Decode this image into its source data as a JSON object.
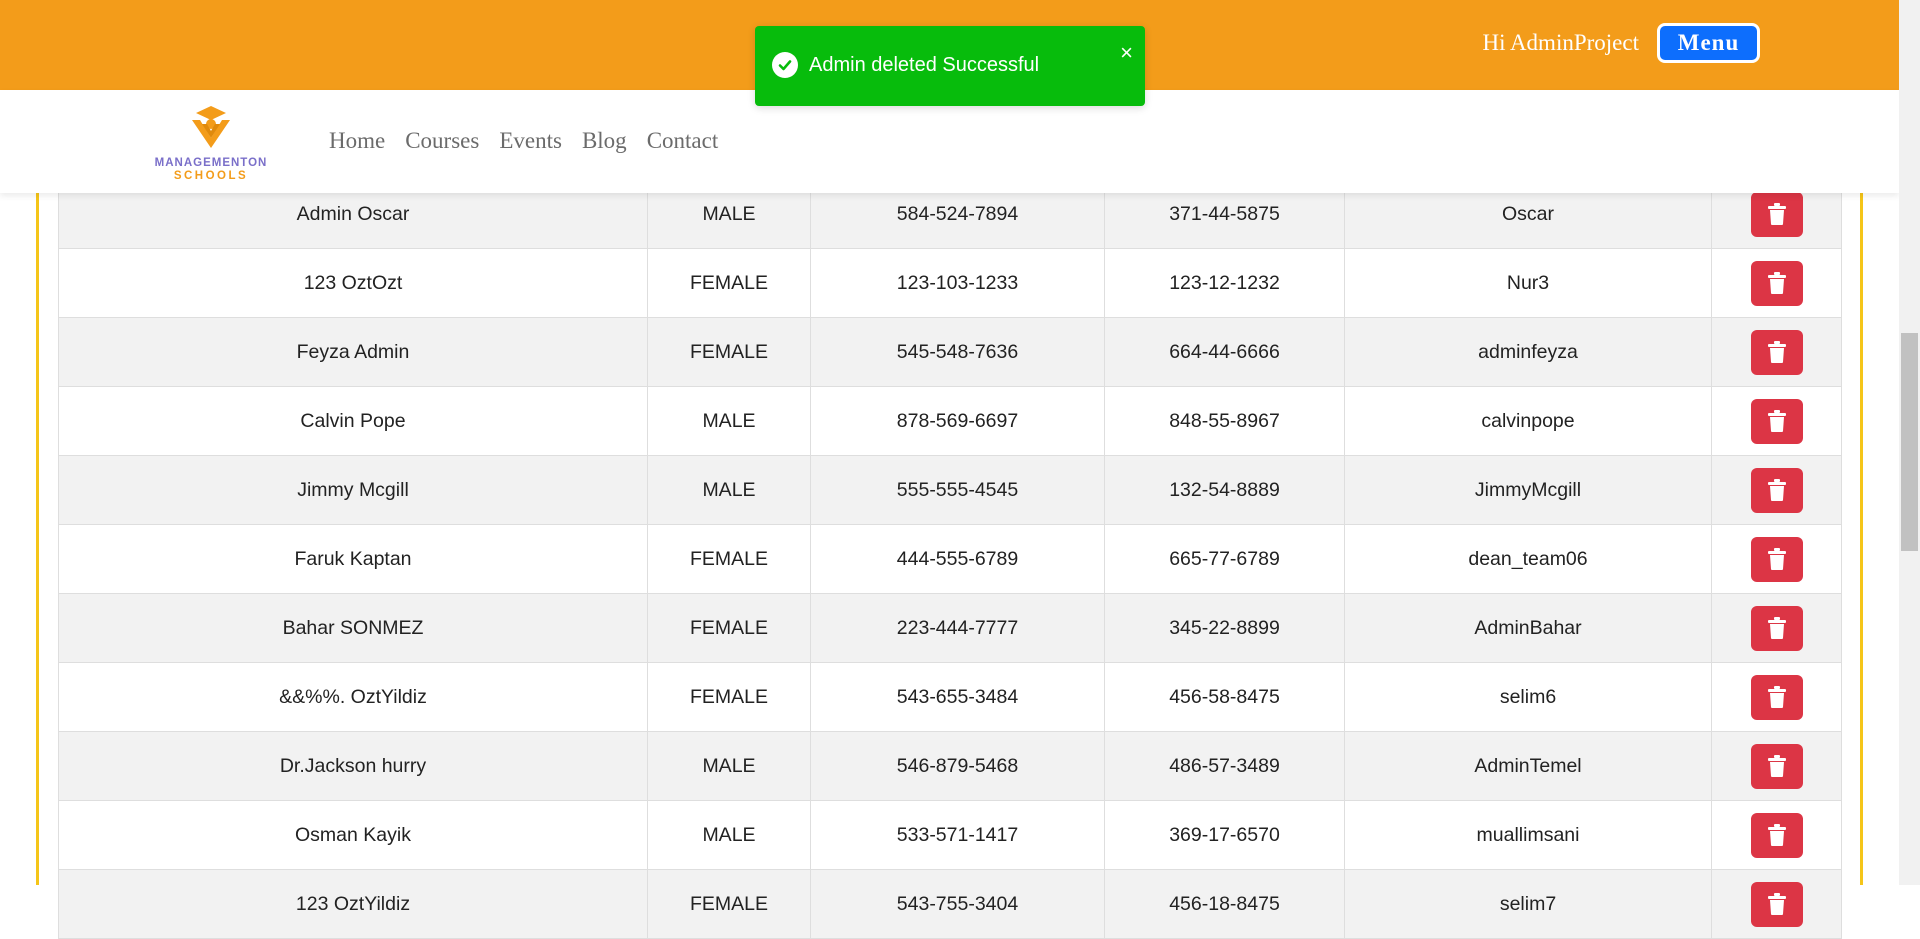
{
  "header": {
    "greeting": "Hi AdminProject",
    "menu_label": "Menu"
  },
  "logo": {
    "line1": "MANAGEMENTON",
    "line2": "SCHOOLS"
  },
  "nav": {
    "items": [
      {
        "label": "Home"
      },
      {
        "label": "Courses"
      },
      {
        "label": "Events"
      },
      {
        "label": "Blog"
      },
      {
        "label": "Contact"
      }
    ]
  },
  "toast": {
    "message": "Admin deleted Successful",
    "close": "×"
  },
  "admins": {
    "rows": [
      {
        "name": "Admin Oscar",
        "gender": "MALE",
        "phone": "584-524-7894",
        "ssn": "371-44-5875",
        "username": "Oscar"
      },
      {
        "name": "123 OztOzt",
        "gender": "FEMALE",
        "phone": "123-103-1233",
        "ssn": "123-12-1232",
        "username": "Nur3"
      },
      {
        "name": "Feyza Admin",
        "gender": "FEMALE",
        "phone": "545-548-7636",
        "ssn": "664-44-6666",
        "username": "adminfeyza"
      },
      {
        "name": "Calvin Pope",
        "gender": "MALE",
        "phone": "878-569-6697",
        "ssn": "848-55-8967",
        "username": "calvinpope"
      },
      {
        "name": "Jimmy Mcgill",
        "gender": "MALE",
        "phone": "555-555-4545",
        "ssn": "132-54-8889",
        "username": "JimmyMcgill"
      },
      {
        "name": "Faruk Kaptan",
        "gender": "FEMALE",
        "phone": "444-555-6789",
        "ssn": "665-77-6789",
        "username": "dean_team06"
      },
      {
        "name": "Bahar SONMEZ",
        "gender": "FEMALE",
        "phone": "223-444-7777",
        "ssn": "345-22-8899",
        "username": "AdminBahar"
      },
      {
        "name": "&&%%. OztYildiz",
        "gender": "FEMALE",
        "phone": "543-655-3484",
        "ssn": "456-58-8475",
        "username": "selim6"
      },
      {
        "name": "Dr.Jackson hurry",
        "gender": "MALE",
        "phone": "546-879-5468",
        "ssn": "486-57-3489",
        "username": "AdminTemel"
      },
      {
        "name": "Osman Kayik",
        "gender": "MALE",
        "phone": "533-571-1417",
        "ssn": "369-17-6570",
        "username": "muallimsani"
      },
      {
        "name": "123 OztYildiz",
        "gender": "FEMALE",
        "phone": "543-755-3404",
        "ssn": "456-18-8475",
        "username": "selim7"
      }
    ]
  },
  "colors": {
    "header_bg": "#f39c1a",
    "menu_button": "#0d6efd",
    "toast_bg": "#07bc0c",
    "delete_button": "#dc3545",
    "frame_border": "#f5c518"
  },
  "icons": {
    "toast": "check-circle-icon",
    "delete": "trash-icon",
    "close": "close-icon"
  }
}
